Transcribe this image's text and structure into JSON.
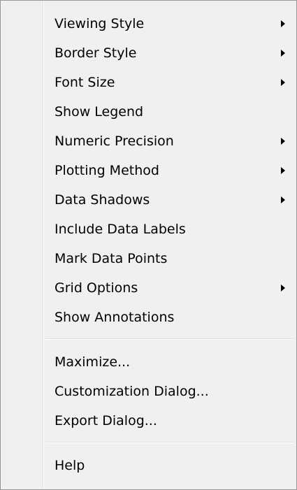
{
  "menu": {
    "items": [
      {
        "label": "Viewing Style",
        "submenu_arrow": "chevron-right-icon"
      },
      {
        "label": "Border Style",
        "submenu_arrow": "chevron-right-icon"
      },
      {
        "label": "Font Size",
        "submenu_arrow": "chevron-right-icon"
      },
      {
        "label": "Show Legend"
      },
      {
        "label": "Numeric Precision",
        "submenu_arrow": "chevron-right-icon"
      },
      {
        "label": "Plotting Method",
        "submenu_arrow": "chevron-right-icon"
      },
      {
        "label": "Data Shadows",
        "submenu_arrow": "chevron-right-icon"
      },
      {
        "label": "Include Data Labels"
      },
      {
        "label": "Mark Data Points"
      },
      {
        "label": "Grid Options",
        "submenu_arrow": "chevron-right-icon"
      },
      {
        "label": "Show Annotations"
      },
      {
        "label": "Maximize..."
      },
      {
        "label": "Customization Dialog..."
      },
      {
        "label": "Export Dialog..."
      },
      {
        "label": "Help"
      }
    ]
  },
  "colors": {
    "menu_background": "#f0f0f0",
    "menu_border": "#979797",
    "text": "#000000"
  }
}
